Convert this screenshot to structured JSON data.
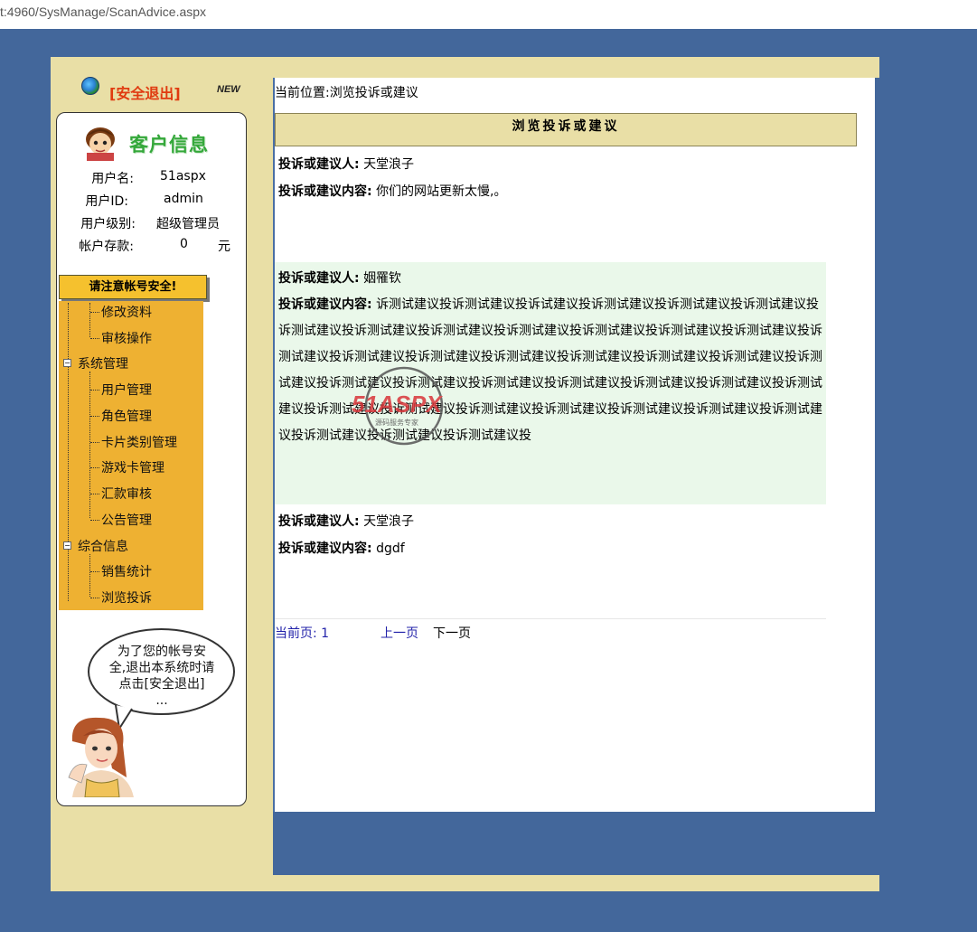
{
  "browser": {
    "url": "t:4960/SysManage/ScanAdvice.aspx"
  },
  "topbar": {
    "logout_label": "[安全退出]",
    "new_badge": "NEW"
  },
  "customer_panel": {
    "title": "客户信息",
    "rows": [
      {
        "label": "用户名:",
        "value": "51aspx"
      },
      {
        "label": "用户ID:",
        "value": "admin"
      },
      {
        "label": "用户级别:",
        "value": "超级管理员"
      },
      {
        "label": "帐户存款:",
        "value": "0",
        "unit": "元"
      }
    ]
  },
  "security_button": {
    "label": "请注意帐号安全!"
  },
  "menu": {
    "items": [
      {
        "label": "修改资料"
      },
      {
        "label": "审核操作"
      },
      {
        "label": "系统管理",
        "group": true
      },
      {
        "label": "用户管理"
      },
      {
        "label": "角色管理"
      },
      {
        "label": "卡片类别管理"
      },
      {
        "label": "游戏卡管理"
      },
      {
        "label": "汇款审核"
      },
      {
        "label": "公告管理"
      },
      {
        "label": "综合信息",
        "group": true
      },
      {
        "label": "销售统计"
      },
      {
        "label": "浏览投诉"
      }
    ]
  },
  "tip_bubble": {
    "lines": [
      "为了您的帐号安",
      "全,退出本系统时请",
      "点击[安全退出]",
      "..."
    ]
  },
  "breadcrumb": "当前位置:浏览投诉或建议",
  "page_title": "浏览投诉或建议",
  "entries": [
    {
      "author_label": "投诉或建议人:",
      "author": "天堂浪子",
      "content_label": "投诉或建议内容:",
      "content": "你们的网站更新太慢,。"
    },
    {
      "author_label": "投诉或建议人:",
      "author": "姻罹钦",
      "content_label": "投诉或建议内容:",
      "content": "诉测试建议投诉测试建议投诉试建议投诉测试建议投诉测试建议投诉测试建议投诉测试建议投诉测试建议投诉测试建议投诉测试建议投诉测试建议投诉测试建议投诉测试建议投诉测试建议投诉测试建议投诉测试建议投诉测试建议投诉测试建议投诉测试建议投诉测试建议投诉测试建议投诉测试建议投诉测试建议投诉测试建议投诉测试建议投诉测试建议投诉测试建议投诉测试建议投诉测试建议投诉测试建议投诉测试建议投诉测试建议投诉测试建议投诉测试建议投诉测试建议投诉测试建议投诉测试建议投诉测试建议投"
    },
    {
      "author_label": "投诉或建议人:",
      "author": "天堂浪子",
      "content_label": "投诉或建议内容:",
      "content": "dgdf"
    }
  ],
  "pager": {
    "current_label": "当前页: 1",
    "prev_label": "上一页",
    "next_label": "下一页"
  },
  "watermark": {
    "brand": "51ASPX",
    "tagline": "源码服务专家"
  },
  "colors": {
    "page_bg": "#43679b",
    "frame": "#e9dfa6",
    "menu_bg": "#eeb132",
    "alt_row": "#eaf8ea",
    "logout": "#e03b10",
    "title_green": "#34a83a",
    "link_blue": "#2222aa"
  }
}
